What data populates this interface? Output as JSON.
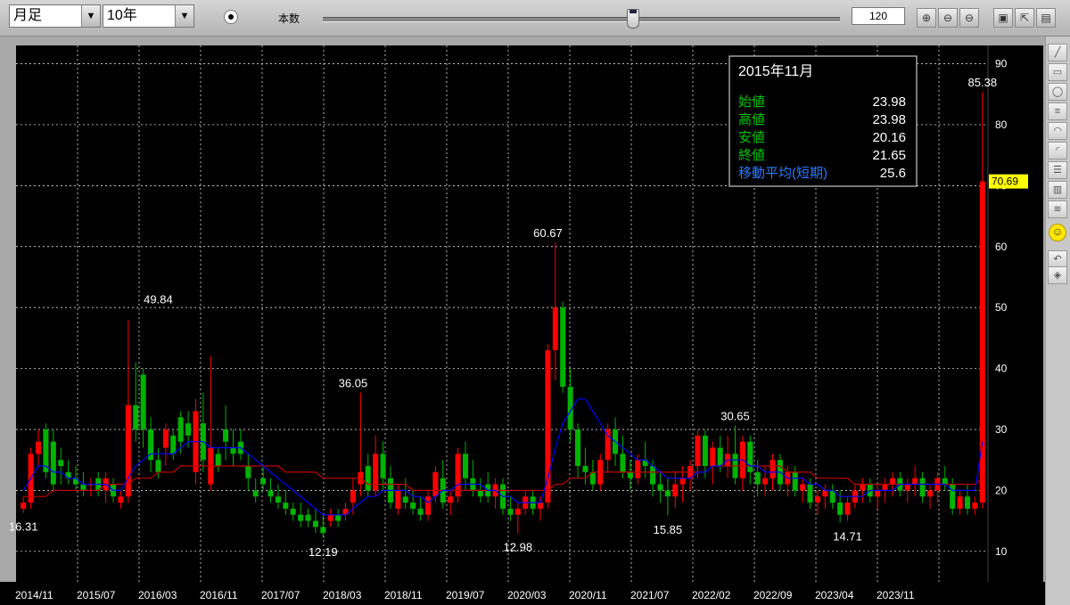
{
  "toolbar": {
    "period": "月足",
    "range": "10年",
    "count_label": "本数",
    "count_value": "120",
    "slider_fraction": 0.6
  },
  "tooltip": {
    "title": "2015年11月",
    "rows": [
      {
        "label": "始値",
        "value": "23.98"
      },
      {
        "label": "高値",
        "value": "23.98"
      },
      {
        "label": "安値",
        "value": "20.16"
      },
      {
        "label": "終値",
        "value": "21.65"
      },
      {
        "label": "移動平均(短期)",
        "value": "25.6"
      }
    ]
  },
  "colors": {
    "up": "#ff0000",
    "down": "#00b300",
    "ma_short": "#0000ff",
    "ma_long": "#c00000",
    "ma_green": "#00aa00",
    "grid": "#ffffff",
    "last_price_bg": "#ffff00"
  },
  "sidebar_icons": [
    "line-tool-icon",
    "rect-tool-icon",
    "ellipse-tool-icon",
    "hlines-tool-icon",
    "fan-tool-icon",
    "arcs-tool-icon",
    "retracement-tool-icon",
    "channel-tool-icon",
    "wave-tool-icon",
    "smiley-icon",
    "undo-icon",
    "eraser-icon"
  ],
  "chart_data": {
    "type": "candlestick",
    "ylim": [
      5,
      93
    ],
    "yticks": [
      10,
      20,
      30,
      40,
      50,
      60,
      70,
      80,
      90
    ],
    "xtick_labels": [
      "2014/11",
      "2015/07",
      "2016/03",
      "2016/11",
      "2017/07",
      "2018/03",
      "2018/11",
      "2019/07",
      "2020/03",
      "2020/11",
      "2021/07",
      "2022/02",
      "2022/09",
      "2023/04",
      "2023/11"
    ],
    "last_price": "70.69",
    "annotations": [
      {
        "text": "16.31",
        "index": 0,
        "value": 16.31
      },
      {
        "text": "49.84",
        "index": 18,
        "value": 49.84
      },
      {
        "text": "12.19",
        "index": 40,
        "value": 12.19
      },
      {
        "text": "36.05",
        "index": 44,
        "value": 36.05
      },
      {
        "text": "12.98",
        "index": 66,
        "value": 12.98
      },
      {
        "text": "60.67",
        "index": 70,
        "value": 60.67
      },
      {
        "text": "15.85",
        "index": 86,
        "value": 15.85
      },
      {
        "text": "30.65",
        "index": 95,
        "value": 30.65
      },
      {
        "text": "14.71",
        "index": 110,
        "value": 14.71
      },
      {
        "text": "85.38",
        "index": 128,
        "value": 85.38
      }
    ],
    "ohlc": [
      [
        17,
        19,
        16.31,
        18
      ],
      [
        18,
        27,
        17,
        26
      ],
      [
        26,
        30,
        24,
        28
      ],
      [
        30,
        31,
        22,
        23
      ],
      [
        28,
        30,
        20,
        21
      ],
      [
        25,
        27,
        21,
        24
      ],
      [
        23,
        25,
        21,
        22
      ],
      [
        22,
        24,
        20,
        21
      ],
      [
        21,
        23,
        19,
        20
      ],
      [
        21,
        22,
        19,
        21
      ],
      [
        22,
        23,
        19,
        20
      ],
      [
        20,
        23,
        18,
        22
      ],
      [
        21,
        22,
        18,
        19
      ],
      [
        18,
        20,
        17,
        19
      ],
      [
        19,
        48,
        18,
        34
      ],
      [
        34,
        41,
        28,
        30
      ],
      [
        39,
        40,
        27,
        30
      ],
      [
        30,
        32,
        23,
        25
      ],
      [
        25,
        27,
        22,
        23
      ],
      [
        27,
        31,
        24,
        30
      ],
      [
        29,
        30,
        25,
        26
      ],
      [
        32,
        33,
        26,
        28
      ],
      [
        31,
        33,
        27,
        29
      ],
      [
        23,
        35,
        21,
        33
      ],
      [
        31,
        36,
        23,
        25
      ],
      [
        21,
        42,
        20,
        27
      ],
      [
        26,
        27,
        23,
        24
      ],
      [
        30,
        34,
        25,
        28
      ],
      [
        27,
        30,
        24,
        26
      ],
      [
        28,
        30,
        25,
        26
      ],
      [
        24,
        26,
        20,
        22
      ],
      [
        20,
        22,
        18,
        19
      ],
      [
        22,
        24,
        20,
        21
      ],
      [
        20,
        22,
        18,
        19
      ],
      [
        19,
        21,
        17,
        18
      ],
      [
        18,
        20,
        16,
        17
      ],
      [
        17,
        18,
        15,
        16
      ],
      [
        16,
        18,
        14,
        15
      ],
      [
        16,
        17,
        14,
        15
      ],
      [
        15,
        17,
        13,
        14
      ],
      [
        14,
        16,
        12.19,
        13
      ],
      [
        15,
        17,
        14,
        16
      ],
      [
        16,
        17,
        14,
        15
      ],
      [
        16,
        18,
        15,
        17
      ],
      [
        18,
        22,
        16,
        20
      ],
      [
        21,
        36.05,
        19,
        23
      ],
      [
        24,
        26,
        19,
        20
      ],
      [
        20,
        29,
        19,
        26
      ],
      [
        26,
        28,
        20,
        22
      ],
      [
        22,
        24,
        17,
        18
      ],
      [
        17,
        21,
        16,
        20
      ],
      [
        19,
        22,
        17,
        18
      ],
      [
        18,
        20,
        16,
        17
      ],
      [
        17,
        19,
        15,
        16
      ],
      [
        16,
        20,
        15,
        19
      ],
      [
        19,
        24,
        18,
        23
      ],
      [
        22,
        25,
        17,
        18
      ],
      [
        18,
        20,
        16,
        19
      ],
      [
        19,
        27,
        18,
        26
      ],
      [
        26,
        28,
        20,
        22
      ],
      [
        22,
        25,
        19,
        20
      ],
      [
        20,
        22,
        18,
        19
      ],
      [
        21,
        23,
        18,
        19
      ],
      [
        19,
        22,
        17,
        21
      ],
      [
        21,
        22,
        16,
        17
      ],
      [
        17,
        19,
        15,
        16
      ],
      [
        16,
        18,
        12.98,
        17
      ],
      [
        17,
        20,
        16,
        19
      ],
      [
        19,
        20,
        16,
        17
      ],
      [
        17,
        19,
        15,
        18
      ],
      [
        18,
        44,
        17,
        43
      ],
      [
        43,
        60.67,
        38,
        50
      ],
      [
        50,
        51,
        36,
        37
      ],
      [
        37,
        40,
        28,
        30
      ],
      [
        30,
        31,
        22,
        24
      ],
      [
        24,
        27,
        21,
        23
      ],
      [
        23,
        25,
        20,
        21
      ],
      [
        21,
        26,
        20,
        25
      ],
      [
        25,
        31,
        23,
        30
      ],
      [
        30,
        32,
        24,
        26
      ],
      [
        26,
        29,
        22,
        23
      ],
      [
        23,
        25,
        20,
        22
      ],
      [
        22,
        26,
        21,
        25
      ],
      [
        25,
        28,
        22,
        24
      ],
      [
        24,
        25,
        19,
        21
      ],
      [
        21,
        23,
        18,
        20
      ],
      [
        20,
        22,
        15.85,
        19
      ],
      [
        19,
        23,
        17,
        21
      ],
      [
        21,
        24,
        18,
        22
      ],
      [
        22,
        25,
        20,
        24
      ],
      [
        24,
        30,
        22,
        29
      ],
      [
        29,
        30,
        22,
        24
      ],
      [
        24,
        28,
        21,
        27
      ],
      [
        27,
        29,
        23,
        24
      ],
      [
        24,
        29,
        22,
        26
      ],
      [
        26,
        30.65,
        21,
        22
      ],
      [
        22,
        29,
        20,
        28
      ],
      [
        28,
        29,
        21,
        23
      ],
      [
        23,
        25,
        19,
        21
      ],
      [
        21,
        24,
        19,
        22
      ],
      [
        22,
        26,
        20,
        25
      ],
      [
        25,
        26,
        20,
        21
      ],
      [
        21,
        24,
        19,
        23
      ],
      [
        23,
        24,
        19,
        20
      ],
      [
        20,
        22,
        18,
        21
      ],
      [
        21,
        22,
        17,
        18
      ],
      [
        18,
        20,
        16,
        19
      ],
      [
        19,
        21,
        17,
        20
      ],
      [
        20,
        21,
        17,
        18
      ],
      [
        18,
        20,
        14.71,
        16
      ],
      [
        16,
        19,
        15,
        18
      ],
      [
        18,
        21,
        17,
        20
      ],
      [
        20,
        22,
        18,
        21
      ],
      [
        21,
        22,
        18,
        19
      ],
      [
        19,
        21,
        17,
        20
      ],
      [
        20,
        22,
        18,
        21
      ],
      [
        21,
        23,
        19,
        22
      ],
      [
        22,
        23,
        19,
        20
      ],
      [
        20,
        22,
        18,
        21
      ],
      [
        21,
        24,
        19,
        22
      ],
      [
        22,
        23,
        18,
        19
      ],
      [
        19,
        21,
        17,
        20
      ],
      [
        20,
        23,
        18,
        22
      ],
      [
        22,
        24,
        20,
        21
      ],
      [
        21,
        22,
        16,
        17
      ],
      [
        17,
        20,
        16,
        19
      ],
      [
        19,
        21,
        16,
        17
      ],
      [
        17,
        19,
        16,
        18
      ],
      [
        18,
        85.38,
        17,
        70.69
      ]
    ],
    "ma_short": [
      20,
      22,
      24,
      24,
      23,
      23,
      22,
      22,
      21,
      21,
      21,
      21,
      20,
      20,
      22,
      24,
      25,
      26,
      26,
      26,
      26,
      27,
      28,
      28,
      28,
      27,
      27,
      27,
      27,
      27,
      26,
      25,
      24,
      23,
      22,
      21,
      20,
      19,
      18,
      17,
      16,
      16,
      16,
      16,
      17,
      18,
      19,
      19,
      20,
      20,
      20,
      20,
      19,
      19,
      18,
      19,
      20,
      20,
      21,
      21,
      21,
      21,
      20,
      20,
      19,
      19,
      18,
      18,
      18,
      18,
      22,
      27,
      31,
      33,
      35,
      35,
      33,
      31,
      29,
      28,
      27,
      26,
      25,
      25,
      24,
      23,
      22,
      22,
      22,
      22,
      23,
      23,
      24,
      24,
      25,
      25,
      25,
      24,
      24,
      23,
      23,
      23,
      22,
      22,
      22,
      21,
      21,
      20,
      20,
      19,
      19,
      19,
      19,
      20,
      20,
      20,
      20,
      21,
      21,
      21,
      21,
      21,
      21,
      21,
      20,
      20,
      20,
      20,
      28
    ],
    "ma_long": [
      19,
      19,
      19,
      19,
      20,
      20,
      20,
      20,
      20,
      20,
      20,
      21,
      21,
      21,
      21,
      22,
      22,
      22,
      23,
      23,
      23,
      24,
      24,
      24,
      24,
      24,
      24,
      24,
      24,
      24,
      24,
      24,
      24,
      24,
      24,
      23,
      23,
      23,
      23,
      23,
      22,
      22,
      22,
      22,
      22,
      22,
      21,
      21,
      21,
      21,
      21,
      21,
      20,
      20,
      20,
      20,
      20,
      20,
      20,
      20,
      20,
      20,
      20,
      20,
      20,
      20,
      20,
      20,
      20,
      20,
      20,
      21,
      21,
      22,
      22,
      22,
      23,
      23,
      23,
      23,
      23,
      23,
      23,
      23,
      23,
      23,
      23,
      23,
      23,
      23,
      23,
      23,
      24,
      24,
      24,
      24,
      24,
      24,
      24,
      24,
      24,
      24,
      23,
      23,
      23,
      23,
      22,
      22,
      22,
      22,
      22,
      21,
      21,
      21,
      21,
      21,
      21,
      21,
      21,
      21,
      21,
      21,
      21,
      21,
      21,
      21,
      21,
      21,
      22
    ]
  }
}
